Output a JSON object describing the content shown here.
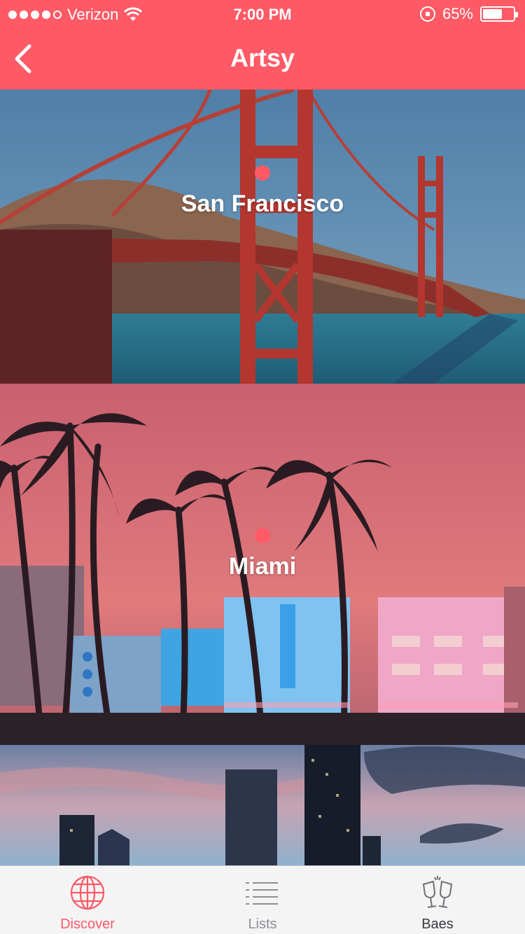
{
  "status_bar": {
    "carrier": "Verizon",
    "time": "7:00 PM",
    "battery_text": "65%",
    "battery_level": 0.65,
    "signal_bars_filled": 4,
    "signal_bars_total": 5
  },
  "nav": {
    "title": "Artsy",
    "back_icon": "chevron-left-icon"
  },
  "cities": [
    {
      "name": "San Francisco"
    },
    {
      "name": "Miami"
    },
    {
      "name": ""
    }
  ],
  "tabs": [
    {
      "label": "Discover",
      "icon": "globe-icon",
      "active": true
    },
    {
      "label": "Lists",
      "icon": "list-icon",
      "active": false
    },
    {
      "label": "Baes",
      "icon": "champagne-glasses-icon",
      "active": false
    }
  ],
  "colors": {
    "accent": "#ff5a66",
    "tab_inactive": "#8e8e93",
    "tab_dark": "#3a3a3f"
  }
}
